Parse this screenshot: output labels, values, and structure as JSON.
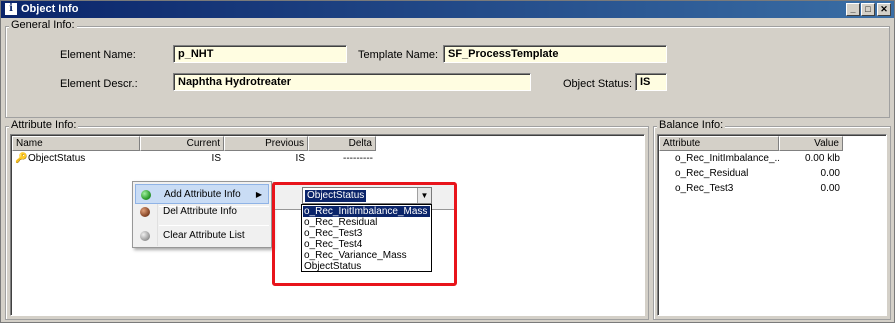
{
  "window": {
    "title": "Object Info",
    "buttons": {
      "minimize": "_",
      "maximize": "□",
      "close": "✕"
    }
  },
  "general_info": {
    "label": "General Info:",
    "element_name_label": "Element Name:",
    "element_name_value": "p_NHT",
    "template_name_label": "Template Name:",
    "template_name_value": "SF_ProcessTemplate",
    "element_descr_label": "Element Descr.:",
    "element_descr_value": "Naphtha Hydrotreater",
    "object_status_label": "Object Status:",
    "object_status_value": "IS"
  },
  "attribute_info": {
    "label": "Attribute Info:",
    "columns": [
      "Name",
      "Current",
      "Previous",
      "Delta"
    ],
    "rows": [
      {
        "name": "ObjectStatus",
        "current": "IS",
        "previous": "IS",
        "delta": "---------",
        "icon": "key-icon"
      }
    ]
  },
  "balance_info": {
    "label": "Balance Info:",
    "columns": [
      "Attribute",
      "Value"
    ],
    "rows": [
      {
        "attribute": "o_Rec_InitImbalance_...",
        "value": "0.00 klb"
      },
      {
        "attribute": "o_Rec_Residual",
        "value": "0.00"
      },
      {
        "attribute": "o_Rec_Test3",
        "value": "0.00"
      }
    ]
  },
  "context_menu": {
    "items": [
      {
        "label": "Add Attribute Info",
        "icon": "green-ball-icon",
        "color": "#2e9e2e",
        "has_submenu": true,
        "selected": true
      },
      {
        "label": "Del Attribute Info",
        "icon": "brown-ball-icon",
        "color": "#8b4a2b",
        "has_submenu": false,
        "selected": false
      },
      {
        "label": "Clear Attribute List",
        "icon": "gray-ball-icon",
        "color": "#a0a0a0",
        "has_submenu": false,
        "selected": false
      }
    ]
  },
  "attribute_combo": {
    "selected_value": "ObjectStatus",
    "options": [
      "o_Rec_InitImbalance_Mass",
      "o_Rec_Residual",
      "o_Rec_Test3",
      "o_Rec_Test4",
      "o_Rec_Variance_Mass",
      "ObjectStatus"
    ],
    "highlighted_option": "o_Rec_InitImbalance_Mass"
  },
  "colors": {
    "highlight_box": "#e8141b",
    "title_bar": "#0a246a",
    "field_background": "#fffde1"
  }
}
